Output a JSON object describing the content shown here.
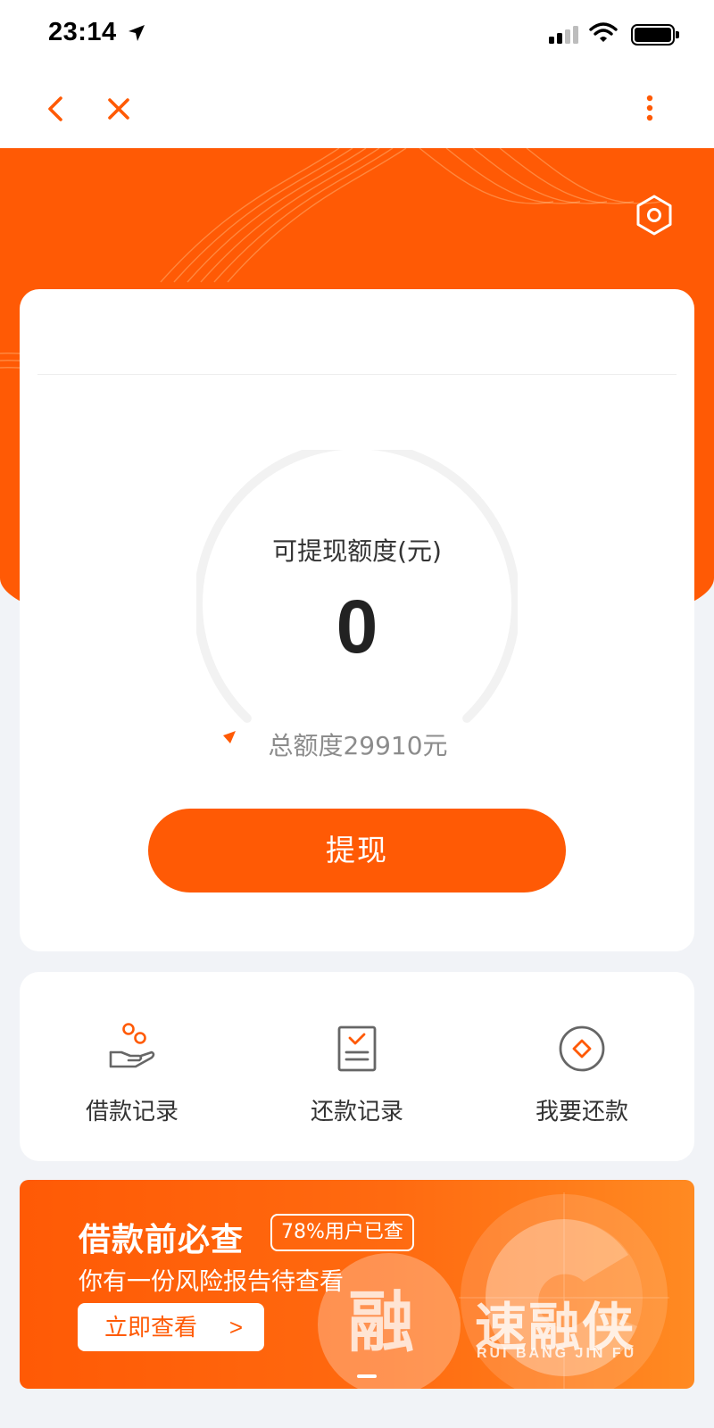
{
  "status_bar": {
    "time": "23:14"
  },
  "colors": {
    "accent": "#ff5a05",
    "background": "#f1f3f7",
    "card": "#ffffff"
  },
  "nav": {
    "back_icon": "chevron-left-icon",
    "close_icon": "close-icon",
    "more_icon": "more-vertical-icon"
  },
  "quota": {
    "label": "可提现额度(元)",
    "available": "0",
    "total_text": "总额度29910元",
    "withdraw_label": "提现"
  },
  "actions": [
    {
      "label": "借款记录",
      "icon": "borrow-coins-icon"
    },
    {
      "label": "还款记录",
      "icon": "repay-checklist-icon"
    },
    {
      "label": "我要还款",
      "icon": "repay-diamond-icon"
    }
  ],
  "banner": {
    "title": "借款前必查",
    "badge": "78%用户已查",
    "subtitle": "你有一份风险报告待查看",
    "button_label": "立即查看",
    "button_chevron": ">",
    "watermark_char": "融",
    "watermark_name": "速融侠",
    "watermark_sub": "RUI BANG JIN FU"
  }
}
